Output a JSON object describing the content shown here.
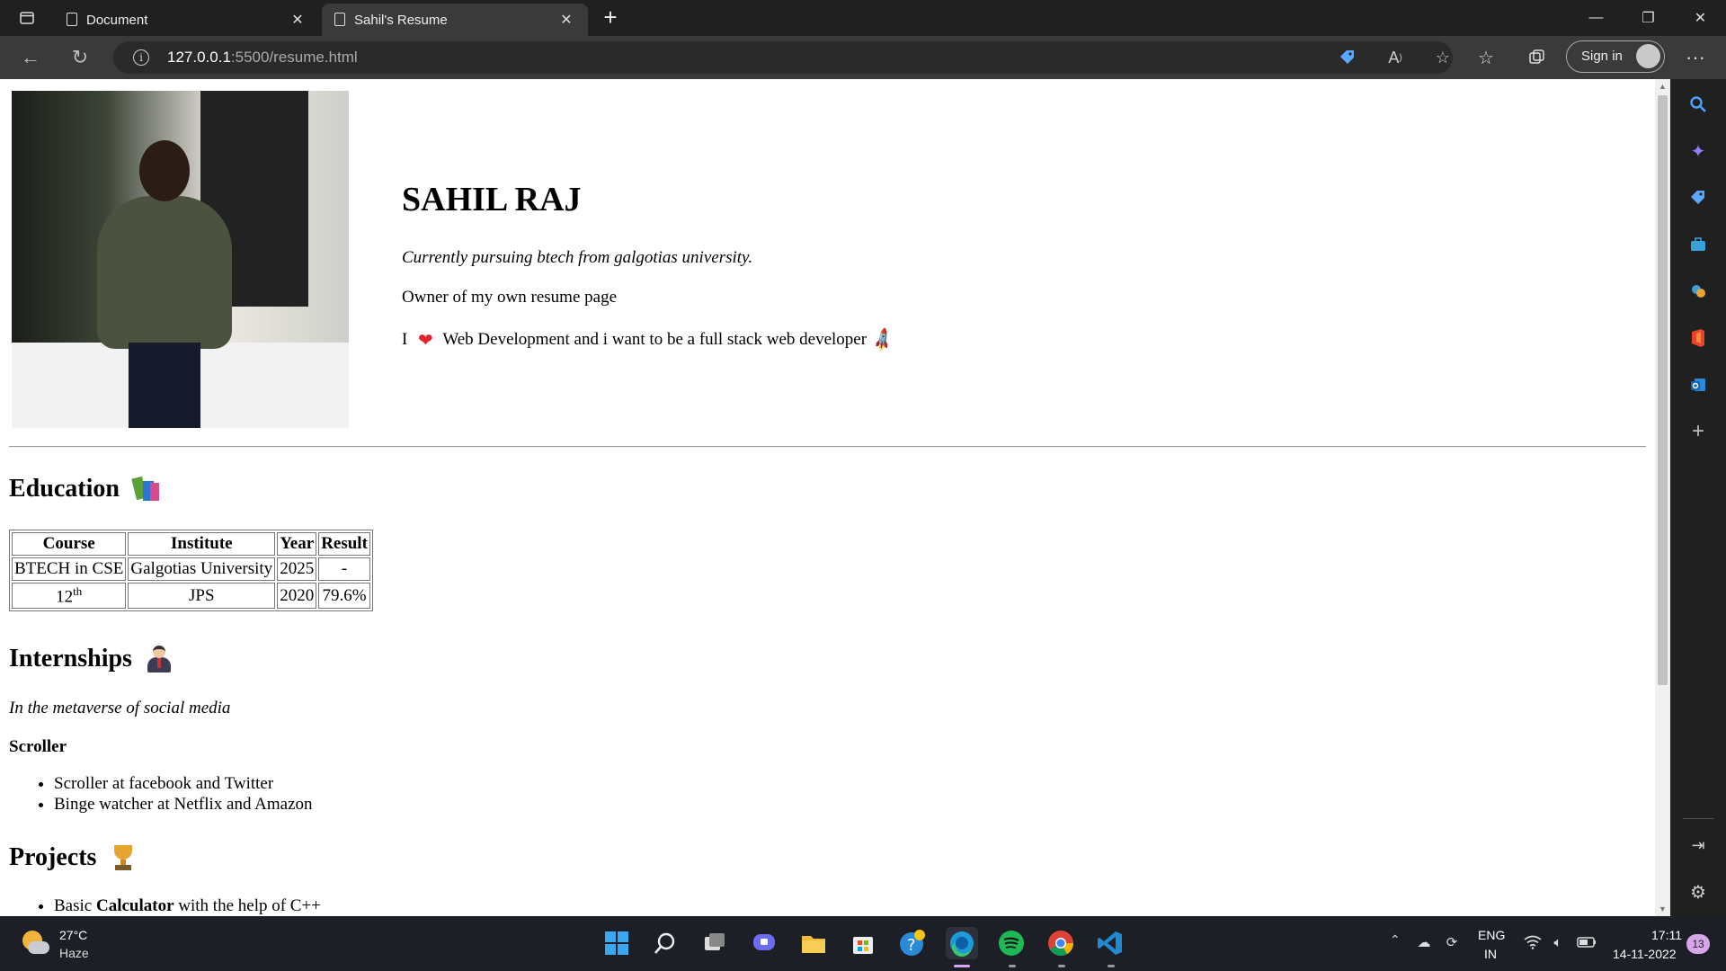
{
  "browser": {
    "tabs": [
      {
        "title": "Document",
        "active": false
      },
      {
        "title": "Sahil's Resume",
        "active": true
      }
    ],
    "url_host": "127.0.0.1",
    "url_rest": ":5500/resume.html",
    "sign_in_label": "Sign in"
  },
  "resume": {
    "photo_alt": "Sahil Raj photo",
    "name": "SAHIL RAJ",
    "tagline": "Currently pursuing btech from galgotias university.",
    "owner_line": "Owner of my own resume page",
    "love_prefix": "I",
    "heart_emoji": "❤",
    "love_text": "Web Development and i want to be a full stack web developer",
    "rocket_emoji": "🚀",
    "education": {
      "heading": "Education",
      "headers": [
        "Course",
        "Institute",
        "Year",
        "Result"
      ],
      "rows": [
        {
          "course": "BTECH in CSE",
          "course_sup": "",
          "institute": "Galgotias University",
          "year": "2025",
          "result": "-"
        },
        {
          "course": "12",
          "course_sup": "th",
          "institute": "JPS",
          "year": "2020",
          "result": "79.6%"
        }
      ]
    },
    "internships": {
      "heading": "Internships",
      "intro": "In the metaverse of social media",
      "role": "Scroller",
      "duties": [
        "Scroller at facebook and Twitter",
        "Binge watcher at Netflix and Amazon"
      ]
    },
    "projects": {
      "heading": "Projects",
      "items": [
        {
          "prefix": "Basic ",
          "bold": "Calculator",
          "suffix": " with the help of C++"
        }
      ]
    }
  },
  "taskbar": {
    "weather_temp": "27°C",
    "weather_cond": "Haze",
    "apps": [
      "windows-start",
      "search",
      "task-view",
      "teams-chat",
      "file-explorer",
      "microsoft-store",
      "help",
      "edge",
      "spotify",
      "chrome",
      "vscode"
    ],
    "lang_top": "ENG",
    "lang_bottom": "IN",
    "time": "17:11",
    "date": "14-11-2022",
    "notification_count": "13"
  },
  "colors": {
    "titlebar": "#202020",
    "toolbar": "#3a3a3a",
    "taskbar": "#1c1f26",
    "heart": "#e0242d"
  }
}
